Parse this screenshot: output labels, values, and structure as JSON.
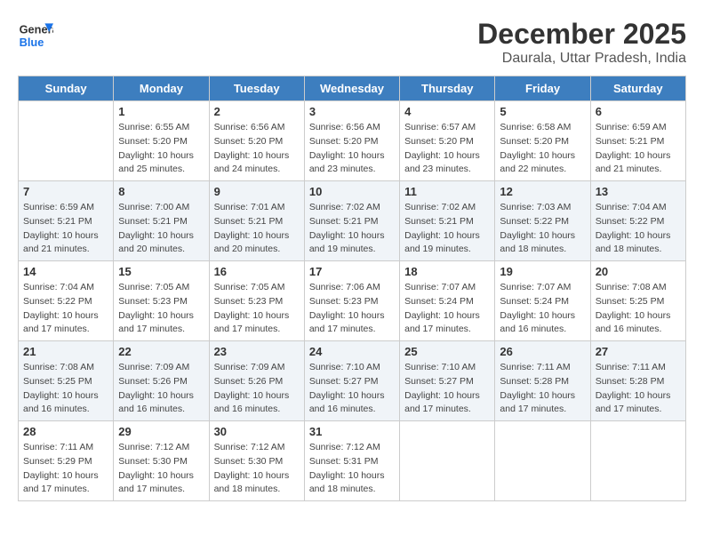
{
  "logo": {
    "line1": "General",
    "line2": "Blue"
  },
  "title": "December 2025",
  "subtitle": "Daurala, Uttar Pradesh, India",
  "headers": [
    "Sunday",
    "Monday",
    "Tuesday",
    "Wednesday",
    "Thursday",
    "Friday",
    "Saturday"
  ],
  "weeks": [
    [
      {
        "day": "",
        "info": ""
      },
      {
        "day": "1",
        "info": "Sunrise: 6:55 AM\nSunset: 5:20 PM\nDaylight: 10 hours\nand 25 minutes."
      },
      {
        "day": "2",
        "info": "Sunrise: 6:56 AM\nSunset: 5:20 PM\nDaylight: 10 hours\nand 24 minutes."
      },
      {
        "day": "3",
        "info": "Sunrise: 6:56 AM\nSunset: 5:20 PM\nDaylight: 10 hours\nand 23 minutes."
      },
      {
        "day": "4",
        "info": "Sunrise: 6:57 AM\nSunset: 5:20 PM\nDaylight: 10 hours\nand 23 minutes."
      },
      {
        "day": "5",
        "info": "Sunrise: 6:58 AM\nSunset: 5:20 PM\nDaylight: 10 hours\nand 22 minutes."
      },
      {
        "day": "6",
        "info": "Sunrise: 6:59 AM\nSunset: 5:21 PM\nDaylight: 10 hours\nand 21 minutes."
      }
    ],
    [
      {
        "day": "7",
        "info": "Sunrise: 6:59 AM\nSunset: 5:21 PM\nDaylight: 10 hours\nand 21 minutes."
      },
      {
        "day": "8",
        "info": "Sunrise: 7:00 AM\nSunset: 5:21 PM\nDaylight: 10 hours\nand 20 minutes."
      },
      {
        "day": "9",
        "info": "Sunrise: 7:01 AM\nSunset: 5:21 PM\nDaylight: 10 hours\nand 20 minutes."
      },
      {
        "day": "10",
        "info": "Sunrise: 7:02 AM\nSunset: 5:21 PM\nDaylight: 10 hours\nand 19 minutes."
      },
      {
        "day": "11",
        "info": "Sunrise: 7:02 AM\nSunset: 5:21 PM\nDaylight: 10 hours\nand 19 minutes."
      },
      {
        "day": "12",
        "info": "Sunrise: 7:03 AM\nSunset: 5:22 PM\nDaylight: 10 hours\nand 18 minutes."
      },
      {
        "day": "13",
        "info": "Sunrise: 7:04 AM\nSunset: 5:22 PM\nDaylight: 10 hours\nand 18 minutes."
      }
    ],
    [
      {
        "day": "14",
        "info": "Sunrise: 7:04 AM\nSunset: 5:22 PM\nDaylight: 10 hours\nand 17 minutes."
      },
      {
        "day": "15",
        "info": "Sunrise: 7:05 AM\nSunset: 5:23 PM\nDaylight: 10 hours\nand 17 minutes."
      },
      {
        "day": "16",
        "info": "Sunrise: 7:05 AM\nSunset: 5:23 PM\nDaylight: 10 hours\nand 17 minutes."
      },
      {
        "day": "17",
        "info": "Sunrise: 7:06 AM\nSunset: 5:23 PM\nDaylight: 10 hours\nand 17 minutes."
      },
      {
        "day": "18",
        "info": "Sunrise: 7:07 AM\nSunset: 5:24 PM\nDaylight: 10 hours\nand 17 minutes."
      },
      {
        "day": "19",
        "info": "Sunrise: 7:07 AM\nSunset: 5:24 PM\nDaylight: 10 hours\nand 16 minutes."
      },
      {
        "day": "20",
        "info": "Sunrise: 7:08 AM\nSunset: 5:25 PM\nDaylight: 10 hours\nand 16 minutes."
      }
    ],
    [
      {
        "day": "21",
        "info": "Sunrise: 7:08 AM\nSunset: 5:25 PM\nDaylight: 10 hours\nand 16 minutes."
      },
      {
        "day": "22",
        "info": "Sunrise: 7:09 AM\nSunset: 5:26 PM\nDaylight: 10 hours\nand 16 minutes."
      },
      {
        "day": "23",
        "info": "Sunrise: 7:09 AM\nSunset: 5:26 PM\nDaylight: 10 hours\nand 16 minutes."
      },
      {
        "day": "24",
        "info": "Sunrise: 7:10 AM\nSunset: 5:27 PM\nDaylight: 10 hours\nand 16 minutes."
      },
      {
        "day": "25",
        "info": "Sunrise: 7:10 AM\nSunset: 5:27 PM\nDaylight: 10 hours\nand 17 minutes."
      },
      {
        "day": "26",
        "info": "Sunrise: 7:11 AM\nSunset: 5:28 PM\nDaylight: 10 hours\nand 17 minutes."
      },
      {
        "day": "27",
        "info": "Sunrise: 7:11 AM\nSunset: 5:28 PM\nDaylight: 10 hours\nand 17 minutes."
      }
    ],
    [
      {
        "day": "28",
        "info": "Sunrise: 7:11 AM\nSunset: 5:29 PM\nDaylight: 10 hours\nand 17 minutes."
      },
      {
        "day": "29",
        "info": "Sunrise: 7:12 AM\nSunset: 5:30 PM\nDaylight: 10 hours\nand 17 minutes."
      },
      {
        "day": "30",
        "info": "Sunrise: 7:12 AM\nSunset: 5:30 PM\nDaylight: 10 hours\nand 18 minutes."
      },
      {
        "day": "31",
        "info": "Sunrise: 7:12 AM\nSunset: 5:31 PM\nDaylight: 10 hours\nand 18 minutes."
      },
      {
        "day": "",
        "info": ""
      },
      {
        "day": "",
        "info": ""
      },
      {
        "day": "",
        "info": ""
      }
    ]
  ]
}
